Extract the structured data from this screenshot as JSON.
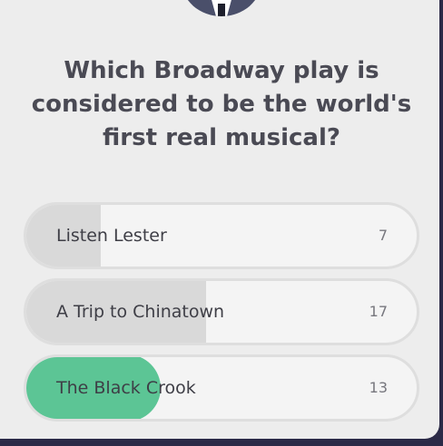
{
  "question": "Which Broadway play is considered to be the world's first real musical?",
  "options": [
    {
      "label": "Listen Lester",
      "count": "7",
      "fill_fraction": 0.19,
      "selected": false
    },
    {
      "label": "A Trip to Chinatown",
      "count": "17",
      "fill_fraction": 0.46,
      "selected": false
    },
    {
      "label": "The Black Crook",
      "count": "13",
      "fill_fraction": 0.35,
      "selected": true
    }
  ],
  "colors": {
    "background": "#2b2a47",
    "card": "#ededed",
    "option_fill": "#d9d9d9",
    "selected_fill": "#5cc595",
    "question_text": "#4a4a54"
  },
  "icons": {
    "avatar": "host-avatar-icon"
  }
}
